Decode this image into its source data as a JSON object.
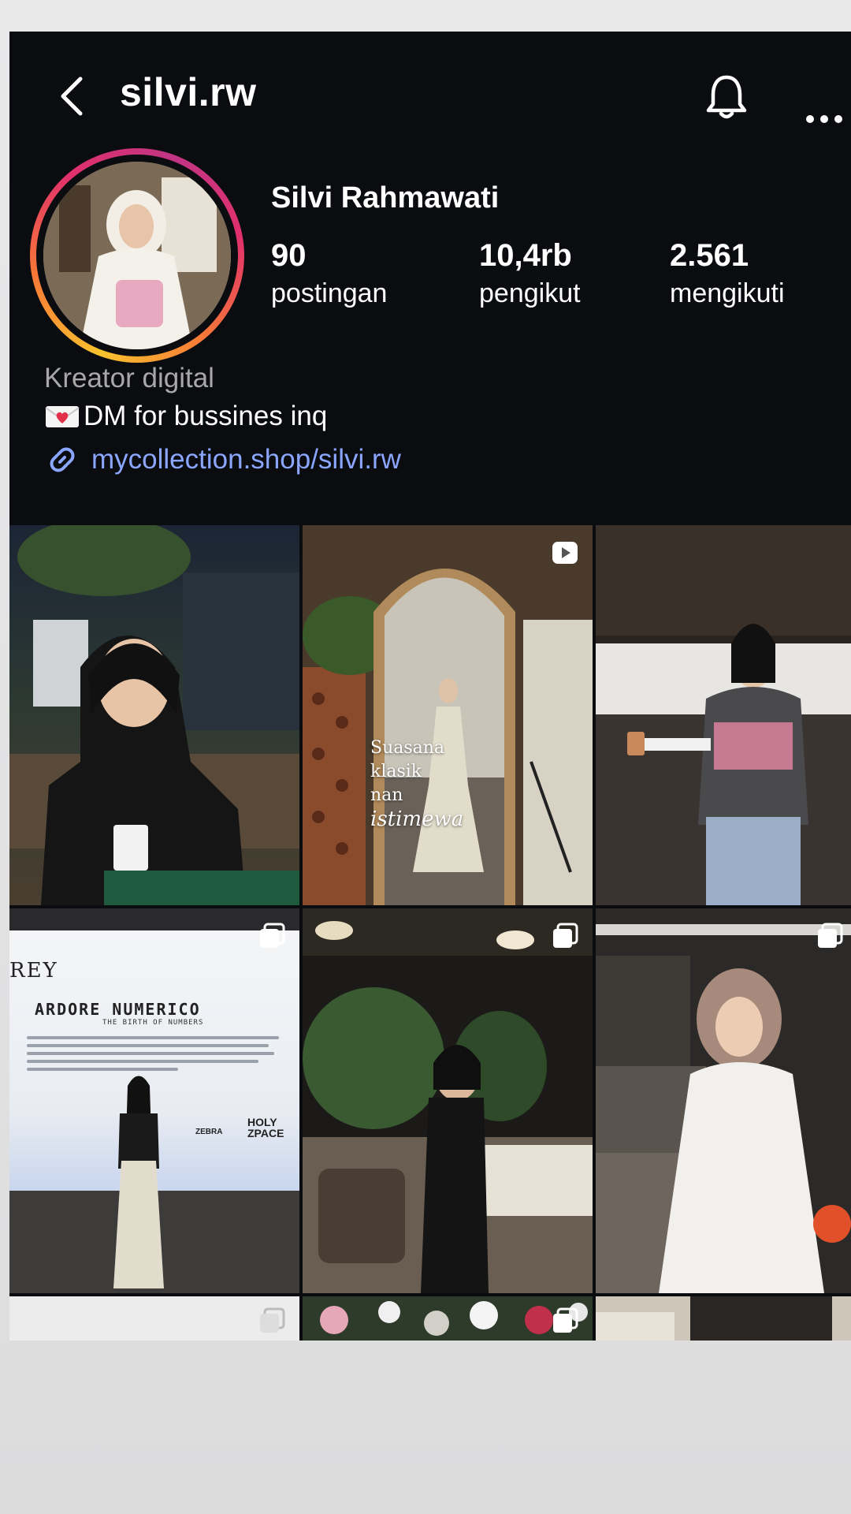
{
  "header": {
    "username": "silvi.rw"
  },
  "profile": {
    "full_name": "Silvi Rahmawati",
    "stats": [
      {
        "value": "90",
        "label": "postingan"
      },
      {
        "value": "10,4rb",
        "label": "pengikut"
      },
      {
        "value": "2.561",
        "label": "mengikuti"
      }
    ],
    "bio": {
      "category": "Kreator digital",
      "line": "DM for bussines inq",
      "link": "mycollection.shop/silvi.rw"
    }
  },
  "posts": {
    "post2_overlay": [
      "Suasana",
      "klasik",
      "nan",
      "istimewa"
    ],
    "post4_poster": {
      "heading": "REY",
      "title": "ARDORE NUMERICO",
      "subtitle": "THE BIRTH OF NUMBERS",
      "sponsor1": "ZEBRA",
      "sponsor2": "HOLY ZPACE"
    }
  },
  "colors": {
    "background": "#0a0c10",
    "text": "#ffffff",
    "muted": "#a8a8a8",
    "link": "#8aa6ff"
  },
  "icons": [
    "back-icon",
    "bell-icon",
    "more-icon",
    "link-icon",
    "heart-mail-icon",
    "reel-icon",
    "carousel-icon"
  ]
}
